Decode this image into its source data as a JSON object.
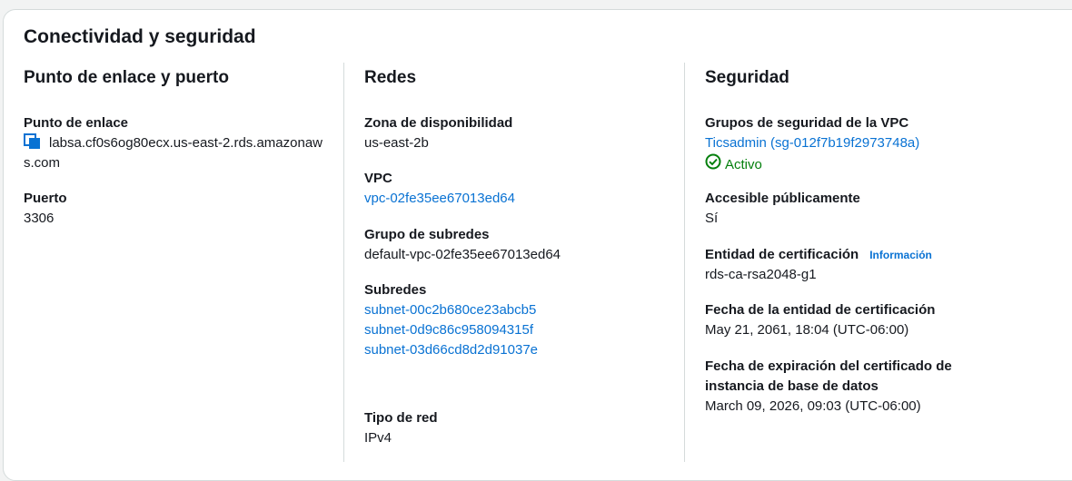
{
  "panel": {
    "title": "Conectividad y seguridad"
  },
  "columns": {
    "endpoint_port": {
      "title": "Punto de enlace y puerto",
      "endpoint_label": "Punto de enlace",
      "endpoint_value": "labsa.cf0s6og80ecx.us-east-2.rds.amazonaws.com",
      "port_label": "Puerto",
      "port_value": "3306"
    },
    "networking": {
      "title": "Redes",
      "az_label": "Zona de disponibilidad",
      "az_value": "us-east-2b",
      "vpc_label": "VPC",
      "vpc_value": "vpc-02fe35ee67013ed64",
      "subnet_group_label": "Grupo de subredes",
      "subnet_group_value": "default-vpc-02fe35ee67013ed64",
      "subnets_label": "Subredes",
      "subnets": [
        "subnet-00c2b680ce23abcb5",
        "subnet-0d9c86c958094315f",
        "subnet-03d66cd8d2d91037e"
      ],
      "network_type_label": "Tipo de red",
      "network_type_value": "IPv4"
    },
    "security": {
      "title": "Seguridad",
      "sg_label": "Grupos de seguridad de la VPC",
      "sg_value": "Ticsadmin (sg-012f7b19f2973748a)",
      "sg_status": "Activo",
      "public_label": "Accesible públicamente",
      "public_value": "Sí",
      "ca_label": "Entidad de certificación",
      "ca_info": "Información",
      "ca_value": "rds-ca-rsa2048-g1",
      "ca_date_label": "Fecha de la entidad de certificación",
      "ca_date_value": "May 21, 2061, 18:04 (UTC-06:00)",
      "cert_exp_label": "Fecha de expiración del certificado de instancia de base de datos",
      "cert_exp_value": "March 09, 2026, 09:03 (UTC-06:00)"
    }
  },
  "colors": {
    "link": "#0972d3",
    "success": "#037f0c",
    "divider": "#d5dbdb"
  },
  "icons": {
    "copy": "copy-icon",
    "status": "check-circle-icon"
  }
}
